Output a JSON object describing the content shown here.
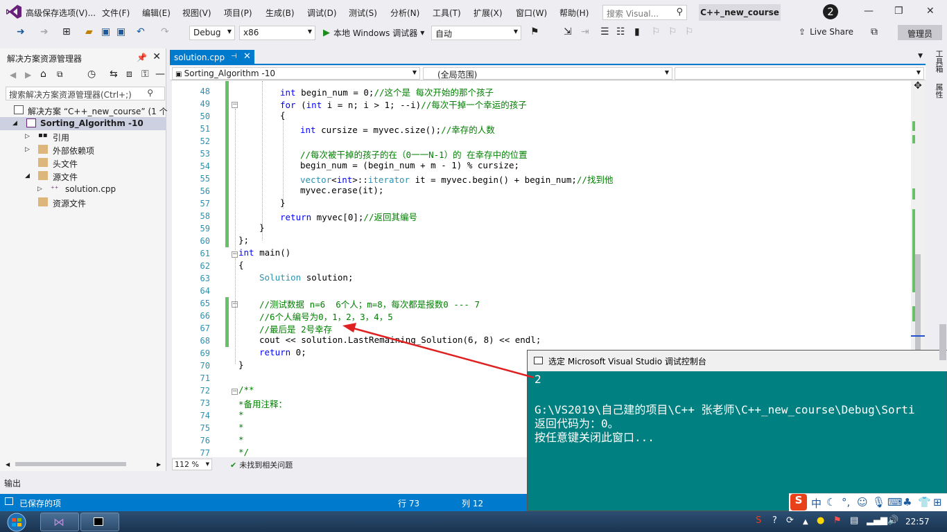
{
  "menubar": {
    "items": [
      "高级保存选项(V)...",
      "文件(F)",
      "编辑(E)",
      "视图(V)",
      "项目(P)",
      "生成(B)",
      "调试(D)",
      "测试(S)",
      "分析(N)",
      "工具(T)",
      "扩展(X)",
      "窗口(W)",
      "帮助(H)"
    ],
    "search_placeholder": "搜索 Visual...",
    "solution_title": "C++_new_course",
    "notification_count": "2"
  },
  "toolbar": {
    "config": "Debug",
    "platform": "x86",
    "run_label": "本地 Windows 调试器",
    "run_mode": "自动",
    "live_share": "Live Share",
    "admin": "管理员"
  },
  "solution_explorer": {
    "title": "解决方案资源管理器",
    "search_placeholder": "搜索解决方案资源管理器(Ctrl+;)",
    "items": [
      {
        "label": "解决方案 “C++_new_course” (1 个"
      },
      {
        "label": "Sorting_Algorithm -10"
      },
      {
        "label": "引用"
      },
      {
        "label": "外部依赖项"
      },
      {
        "label": "头文件"
      },
      {
        "label": "源文件"
      },
      {
        "label": "solution.cpp"
      },
      {
        "label": "资源文件"
      }
    ]
  },
  "editor": {
    "tab": "solution.cpp",
    "nav_project": "Sorting_Algorithm -10",
    "nav_scope": "(全局范围)",
    "zoom": "112 %",
    "issues": "未找到相关问题",
    "line_numbers": [
      "48",
      "49",
      "50",
      "51",
      "52",
      "53",
      "54",
      "55",
      "56",
      "57",
      "58",
      "59",
      "60",
      "61",
      "62",
      "63",
      "64",
      "65",
      "66",
      "67",
      "68",
      "69",
      "70",
      "71",
      "72",
      "73",
      "74",
      "75",
      "76",
      "77"
    ]
  },
  "code": {
    "l48a": "int",
    "l48b": " begin_num = 0;",
    "l48c": "//这个是 每次开始的那个孩子",
    "l49a": "for",
    "l49b": " (",
    "l49c": "int",
    "l49d": " i = n; i > 1; --i)",
    "l49e": "//每次干掉一个幸运的孩子",
    "l50": "{",
    "l51a": "int",
    "l51b": " cursize = myvec.size();",
    "l51c": "//幸存的人数",
    "l53": "//每次被干掉的孩子的在（0一一N-1）的 在幸存中的位置",
    "l54": "begin_num = (begin_num + m - 1) % cursize;",
    "l55a": "vector",
    "l55b": "<",
    "l55c": "int",
    "l55d": ">::",
    "l55e": "iterator",
    "l55f": " it = myvec.begin() + begin_num;",
    "l55g": "//找到他",
    "l56": "myvec.erase(it);",
    "l57": "}",
    "l58a": "return",
    "l58b": " myvec[0];",
    "l58c": "//返回其编号",
    "l59": "}",
    "l60": "};",
    "l61a": "int",
    "l61b": " main()",
    "l62": "{",
    "l63a": "Solution",
    "l63b": " solution;",
    "l65": "//测试数据 n=6  6个人；m=8，每次都是报数0 --- 7",
    "l66": "//6个人编号为0，1，2，3，4，5",
    "l67": "//最后是 2号幸存",
    "l68": "cout << solution.LastRemaining_Solution(6, 8) << endl;",
    "l69a": "return",
    "l69b": " 0;",
    "l70": "}",
    "l72": "/**",
    "l73": "*备用注释：",
    "l74": "*",
    "l75": "*",
    "l76": "*",
    "l77": "*/"
  },
  "output_panel": {
    "label": "输出"
  },
  "statusbar": {
    "state": "已保存的项",
    "line": "行 73",
    "col": "列 12"
  },
  "console": {
    "title": "选定 Microsoft Visual Studio 调试控制台",
    "line1": "2",
    "line2": "G:\\VS2019\\自己建的项目\\C++ 张老师\\C++_new_course\\Debug\\Sorti",
    "line3": "返回代码为：0。",
    "line4": "按任意键关闭此窗口..."
  },
  "right_strip": {
    "tab1": "工具箱",
    "tab2": "属性"
  },
  "ime": {
    "lang": "中"
  },
  "taskbar": {
    "clock": "22:57"
  },
  "colors": {
    "accent": "#007acc",
    "console_bg": "#008080",
    "arrow": "#e02020"
  }
}
